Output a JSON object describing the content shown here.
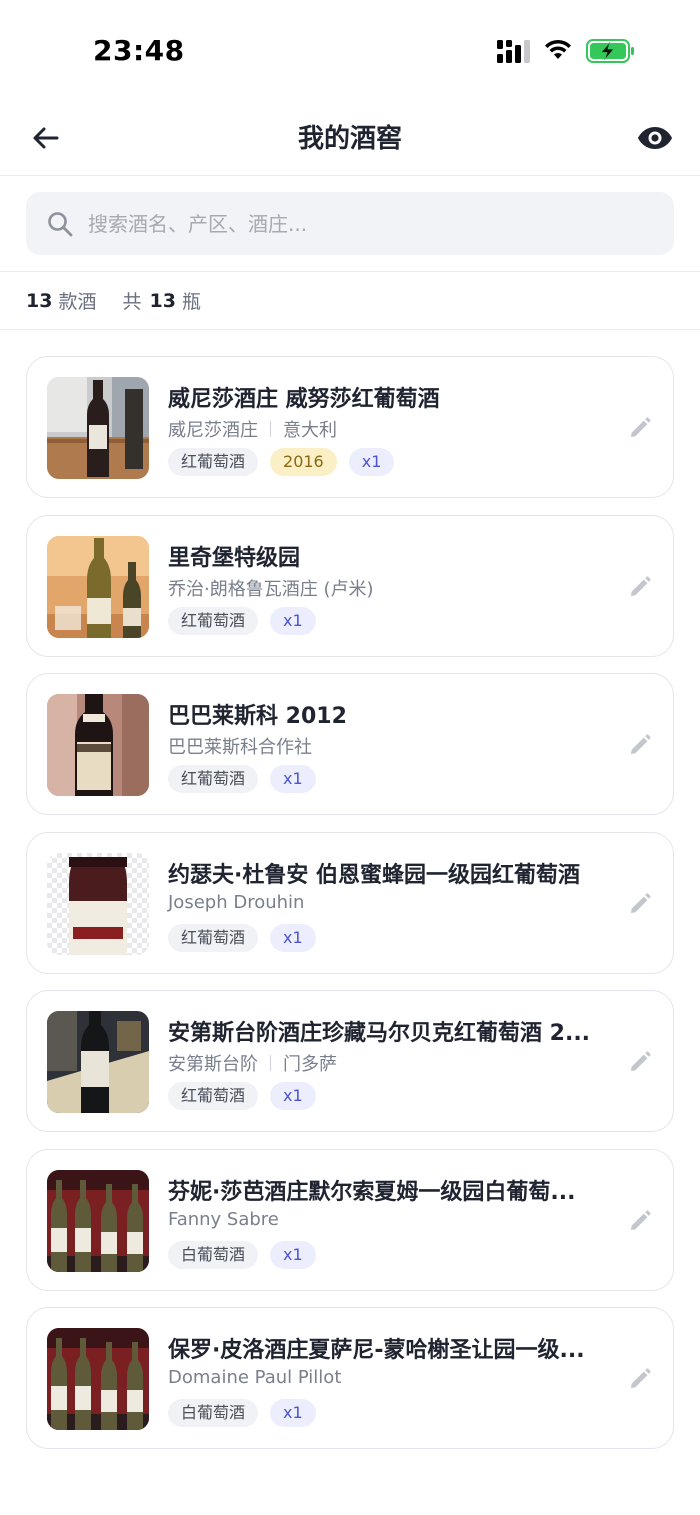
{
  "status_bar": {
    "time": "23:48"
  },
  "nav": {
    "title": "我的酒窖"
  },
  "search": {
    "placeholder": "搜索酒名、产区、酒庄..."
  },
  "summary": {
    "types_count": "13",
    "types_unit": "款酒",
    "total_prefix": "共",
    "total_count": "13",
    "total_unit": "瓶"
  },
  "wines": [
    {
      "name": "威尼莎酒庄 威努莎红葡萄酒",
      "producer": "威尼莎酒庄",
      "region": "意大利",
      "type": "红葡萄酒",
      "vintage": "2016",
      "qty": "x1"
    },
    {
      "name": "里奇堡特级园",
      "producer": "乔治·朗格鲁瓦酒庄 (卢米)",
      "region": "",
      "type": "红葡萄酒",
      "vintage": "",
      "qty": "x1"
    },
    {
      "name": "巴巴莱斯科 2012",
      "producer": "巴巴莱斯科合作社",
      "region": "",
      "type": "红葡萄酒",
      "vintage": "",
      "qty": "x1"
    },
    {
      "name": "约瑟夫·杜鲁安 伯恩蜜蜂园一级园红葡萄酒",
      "producer": "Joseph Drouhin",
      "region": "",
      "type": "红葡萄酒",
      "vintage": "",
      "qty": "x1"
    },
    {
      "name": "安第斯台阶酒庄珍藏马尔贝克红葡萄酒 2...",
      "producer": "安第斯台阶",
      "region": "门多萨",
      "type": "红葡萄酒",
      "vintage": "",
      "qty": "x1"
    },
    {
      "name": "芬妮·莎芭酒庄默尔索夏姆一级园白葡萄...",
      "producer": "Fanny Sabre",
      "region": "",
      "type": "白葡萄酒",
      "vintage": "",
      "qty": "x1"
    },
    {
      "name": "保罗·皮洛酒庄夏萨尼-蒙哈榭圣让园一级...",
      "producer": "Domaine Paul Pillot",
      "region": "",
      "type": "白葡萄酒",
      "vintage": "",
      "qty": "x1"
    }
  ],
  "colors": {
    "accent": "#4a55cf",
    "year_tag_bg": "#fbefc6",
    "battery": "#34c759"
  }
}
